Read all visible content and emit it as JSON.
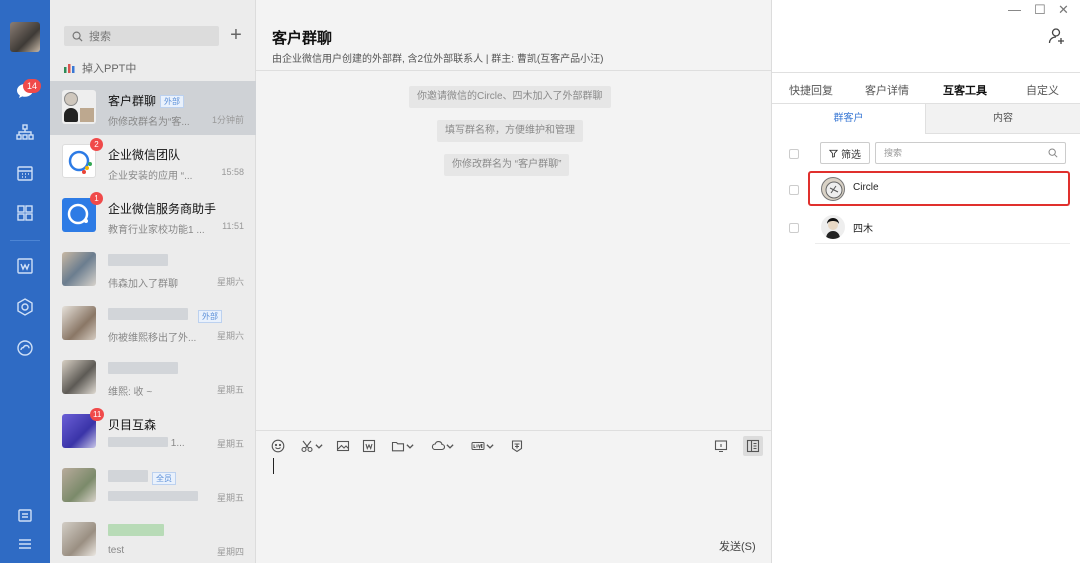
{
  "nav": {
    "badge": "14"
  },
  "list": {
    "search_placeholder": "搜索",
    "ppt_label": "掉入PPT中",
    "conversations": [
      {
        "name": "客户群聊",
        "tag": "外部",
        "preview": "你修改群名为“客...",
        "time": "1分钟前"
      },
      {
        "name": "企业微信团队",
        "preview": "企业安装的应用 “...",
        "time": "15:58",
        "badge": "2"
      },
      {
        "name": "企业微信服务商助手",
        "preview": "教育行业家校功能1 ...",
        "time": "11:51",
        "badge": "1"
      },
      {
        "preview": "伟森加入了群聊",
        "time": "星期六"
      },
      {
        "tag": "外部",
        "preview": "你被维熙移出了外...",
        "time": "星期六"
      },
      {
        "preview": "维熙: 收 ~",
        "time": "星期五"
      },
      {
        "name": "贝目互森",
        "preview": "1...",
        "time": "星期五",
        "badge": "11"
      },
      {
        "tag": "全员",
        "time": "星期五"
      },
      {
        "preview": "test",
        "time": "星期四"
      }
    ]
  },
  "chat": {
    "title": "客户群聊",
    "subtitle": "由企业微信用户创建的外部群, 含2位外部联系人 | 群主: 曹凯(互客产品小汪)",
    "system_messages": [
      "你邀请微信的Circle、四木加入了外部群聊",
      "填写群名称，方便维护和管理",
      "你修改群名为 “客户群聊”"
    ],
    "send_label": "发送(S)"
  },
  "right": {
    "tabs": [
      "快捷回复",
      "客户详情",
      "互客工具",
      "自定义"
    ],
    "active_tab": "互客工具",
    "subtabs": [
      "群客户",
      "内容"
    ],
    "filter_label": "筛选",
    "search_placeholder": "搜索",
    "members": [
      {
        "name": "Circle"
      },
      {
        "name": "四木"
      }
    ]
  },
  "colors": {
    "nav": "#2f6bc4",
    "accent": "#3a78d4",
    "highlight": "#e0302d",
    "badge": "#f04a4a"
  }
}
